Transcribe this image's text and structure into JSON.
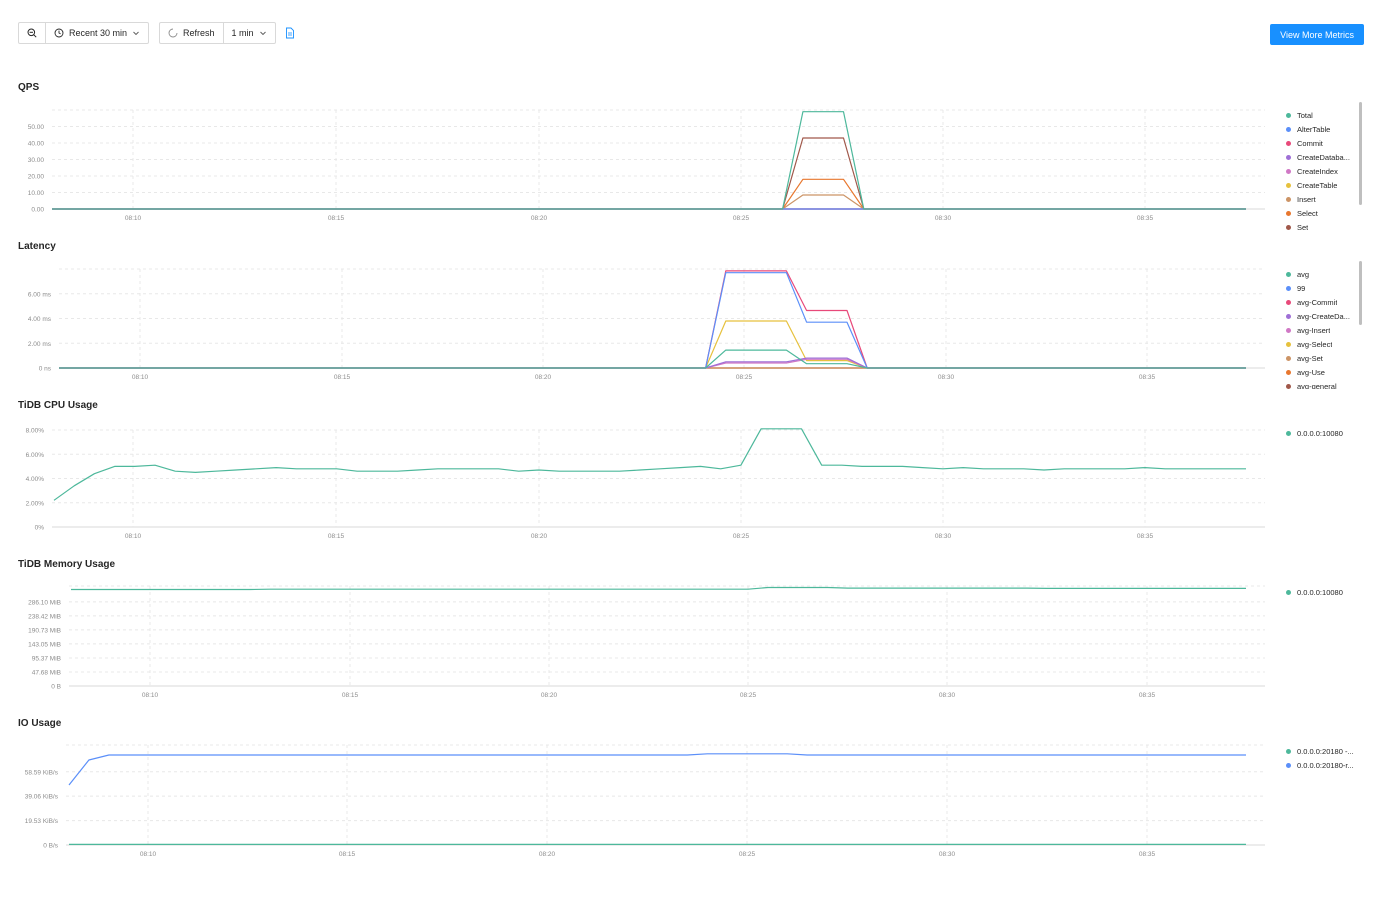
{
  "toolbar": {
    "zoom_icon": "zoom-out-icon",
    "time_range_label": "Recent 30 min",
    "refresh_label": "Refresh",
    "interval_label": "1 min",
    "view_more_label": "View More Metrics"
  },
  "x_ticks": [
    "08:10",
    "08:15",
    "08:20",
    "08:25",
    "08:30",
    "08:35"
  ],
  "colors": {
    "green": "#4DB89B",
    "blue": "#5B8FF9",
    "pink": "#E8497A",
    "purple": "#9F6FD6",
    "orchid": "#D078C5",
    "yellow": "#E6C13D",
    "tan": "#CC9466",
    "orange": "#E8772E",
    "brown": "#A0584A"
  },
  "panels": [
    {
      "title": "QPS",
      "legend": [
        "Total",
        "AlterTable",
        "Commit",
        "CreateDataba...",
        "CreateIndex",
        "CreateTable",
        "Insert",
        "Select",
        "Set"
      ]
    },
    {
      "title": "Latency",
      "legend": [
        "avg",
        "99",
        "avg-Commit",
        "avg-CreateDa...",
        "avg-Insert",
        "avg-Select",
        "avg-Set",
        "avg-Use",
        "avg-general"
      ]
    },
    {
      "title": "TiDB CPU Usage",
      "legend": [
        "0.0.0.0:10080"
      ]
    },
    {
      "title": "TiDB Memory Usage",
      "legend": [
        "0.0.0.0:10080"
      ]
    },
    {
      "title": "IO Usage",
      "legend": [
        "0.0.0.0:20180 -...",
        "0.0.0.0:20180-r..."
      ]
    }
  ],
  "chart_data": [
    {
      "type": "line",
      "title": "QPS",
      "x": [
        "08:08",
        "08:26",
        "08:26.5",
        "08:27.5",
        "08:28",
        "08:37.5"
      ],
      "y_ticks": [
        "0.00",
        "10.00",
        "20.00",
        "30.00",
        "40.00",
        "50.00"
      ],
      "ylim": [
        0,
        60
      ],
      "legend_position": "right",
      "grid": true,
      "series": [
        {
          "name": "Total",
          "color": "#4DB89B",
          "values": [
            0,
            0,
            59,
            59,
            0,
            0
          ]
        },
        {
          "name": "AlterTable",
          "color": "#5B8FF9",
          "values": [
            0,
            0,
            0,
            0,
            0,
            0
          ]
        },
        {
          "name": "Commit",
          "color": "#E8497A",
          "values": [
            0,
            0,
            0,
            0,
            0,
            0
          ]
        },
        {
          "name": "CreateDataba...",
          "color": "#9F6FD6",
          "values": [
            0,
            0,
            0,
            0,
            0,
            0
          ]
        },
        {
          "name": "CreateIndex",
          "color": "#D078C5",
          "values": [
            0,
            0,
            0,
            0,
            0,
            0
          ]
        },
        {
          "name": "CreateTable",
          "color": "#E6C13D",
          "values": [
            0,
            0,
            0,
            0,
            0,
            0
          ]
        },
        {
          "name": "Insert",
          "color": "#CC9466",
          "values": [
            0,
            0,
            8.5,
            8.5,
            0,
            0
          ]
        },
        {
          "name": "Select",
          "color": "#E8772E",
          "values": [
            0,
            0,
            18,
            18,
            0,
            0
          ]
        },
        {
          "name": "Set",
          "color": "#A0584A",
          "values": [
            0,
            0,
            43,
            43,
            0,
            0
          ]
        }
      ]
    },
    {
      "type": "line",
      "title": "Latency",
      "x": [
        "08:08",
        "08:24",
        "08:24.5",
        "08:26",
        "08:26.5",
        "08:27.5",
        "08:28",
        "08:37.5"
      ],
      "y_ticks": [
        "0 ns",
        "2.00 ms",
        "4.00 ms",
        "6.00 ms"
      ],
      "ylim": [
        0,
        8
      ],
      "legend_position": "right",
      "grid": true,
      "series": [
        {
          "name": "avg",
          "color": "#4DB89B",
          "values": [
            0,
            0,
            1.45,
            1.45,
            0.35,
            0.35,
            0,
            0
          ]
        },
        {
          "name": "99",
          "color": "#5B8FF9",
          "values": [
            0,
            0,
            7.7,
            7.7,
            3.7,
            3.7,
            0,
            0
          ]
        },
        {
          "name": "avg-Commit",
          "color": "#E8497A",
          "values": [
            0,
            0,
            7.85,
            7.85,
            4.65,
            4.65,
            0,
            0
          ]
        },
        {
          "name": "avg-CreateDa...",
          "color": "#9F6FD6",
          "values": [
            0,
            0,
            0.5,
            0.5,
            0.8,
            0.8,
            0,
            0
          ]
        },
        {
          "name": "avg-Insert",
          "color": "#D078C5",
          "values": [
            0,
            0,
            0.4,
            0.4,
            0.7,
            0.7,
            0,
            0
          ]
        },
        {
          "name": "avg-Select",
          "color": "#E6C13D",
          "values": [
            0,
            0,
            3.8,
            3.8,
            0.6,
            0.6,
            0,
            0
          ]
        },
        {
          "name": "avg-Set",
          "color": "#CC9466",
          "values": [
            0,
            0,
            0,
            0,
            0,
            0,
            0,
            0
          ]
        },
        {
          "name": "avg-Use",
          "color": "#E8772E",
          "values": [
            0,
            0,
            0,
            0,
            0,
            0,
            0,
            0
          ]
        },
        {
          "name": "avg-general",
          "color": "#A0584A",
          "values": [
            0,
            0,
            0,
            0,
            0,
            0,
            0,
            0
          ]
        }
      ]
    },
    {
      "type": "line",
      "title": "TiDB CPU Usage",
      "x_range": [
        "08:08",
        "08:37.5"
      ],
      "y_ticks": [
        "0%",
        "2.00%",
        "4.00%",
        "6.00%",
        "8.00%"
      ],
      "ylim": [
        0,
        8
      ],
      "legend_position": "right",
      "grid": true,
      "series": [
        {
          "name": "0.0.0.0:10080",
          "color": "#4DB89B",
          "values": [
            2.2,
            3.4,
            4.4,
            5.0,
            5.0,
            5.1,
            4.6,
            4.5,
            4.6,
            4.7,
            4.8,
            4.9,
            4.8,
            4.8,
            4.8,
            4.6,
            4.6,
            4.6,
            4.7,
            4.8,
            4.8,
            4.8,
            4.8,
            4.6,
            4.7,
            4.6,
            4.6,
            4.6,
            4.6,
            4.7,
            4.8,
            4.9,
            5.0,
            4.8,
            5.1,
            8.1,
            8.1,
            8.1,
            5.1,
            5.1,
            5.0,
            5.0,
            5.0,
            4.9,
            4.8,
            4.9,
            4.8,
            4.8,
            4.8,
            4.7,
            4.8,
            4.8,
            4.8,
            4.8,
            4.9,
            4.8,
            4.8,
            4.8,
            4.8,
            4.8
          ]
        }
      ]
    },
    {
      "type": "line",
      "title": "TiDB Memory Usage",
      "x_range": [
        "08:08",
        "08:37.5"
      ],
      "y_ticks": [
        "0 B",
        "47.68 MiB",
        "95.37 MiB",
        "143.05 MiB",
        "190.73 MiB",
        "238.42 MiB",
        "286.10 MiB"
      ],
      "ylim": [
        0,
        340
      ],
      "legend_position": "right",
      "grid": true,
      "series": [
        {
          "name": "0.0.0.0:10080",
          "color": "#4DB89B",
          "values": [
            328,
            328,
            328,
            328,
            328,
            328,
            328,
            328,
            328,
            328,
            329,
            329,
            329,
            329,
            329,
            329,
            329,
            329,
            329,
            329,
            329,
            329,
            329,
            329,
            329,
            329,
            329,
            329,
            329,
            329,
            329,
            329,
            329,
            329,
            329,
            335,
            335,
            335,
            335,
            333,
            333,
            333,
            333,
            333,
            333,
            333,
            333,
            333,
            333,
            332,
            332,
            332,
            332,
            332,
            332,
            332,
            332,
            332,
            332,
            332
          ]
        }
      ]
    },
    {
      "type": "line",
      "title": "IO Usage",
      "x_range": [
        "08:08.5",
        "08:37.5"
      ],
      "y_ticks": [
        "0 B/s",
        "19.53 KiB/s",
        "39.06 KiB/s",
        "58.59 KiB/s"
      ],
      "ylim": [
        0,
        80
      ],
      "legend_position": "right",
      "grid": true,
      "series": [
        {
          "name": "0.0.0.0:20180 -...",
          "color": "#4DB89B",
          "values": [
            0.5,
            0.5,
            0.5,
            0.5,
            0.5,
            0.5,
            0.5,
            0.5,
            0.5,
            0.5,
            0.5,
            0.5,
            0.5,
            0.5,
            0.5,
            0.5,
            0.5,
            0.5,
            0.5,
            0.5,
            0.5,
            0.5,
            0.5,
            0.5,
            0.5,
            0.5,
            0.5,
            0.5,
            0.5,
            0.5
          ]
        },
        {
          "name": "0.0.0.0:20180-r...",
          "color": "#5B8FF9",
          "values": [
            48,
            68,
            72,
            72,
            72,
            72,
            72,
            72,
            72,
            72,
            72,
            72,
            72,
            72,
            72,
            72,
            72,
            72,
            72,
            72,
            72,
            72,
            72,
            72,
            72,
            72,
            72,
            72,
            72,
            72,
            72,
            72,
            73,
            73,
            73,
            73,
            73,
            72,
            72,
            72,
            72,
            72,
            72,
            72,
            72,
            72,
            72,
            72,
            72,
            72,
            72,
            72,
            72,
            72,
            72,
            72,
            72,
            72,
            72,
            72
          ]
        }
      ]
    }
  ]
}
